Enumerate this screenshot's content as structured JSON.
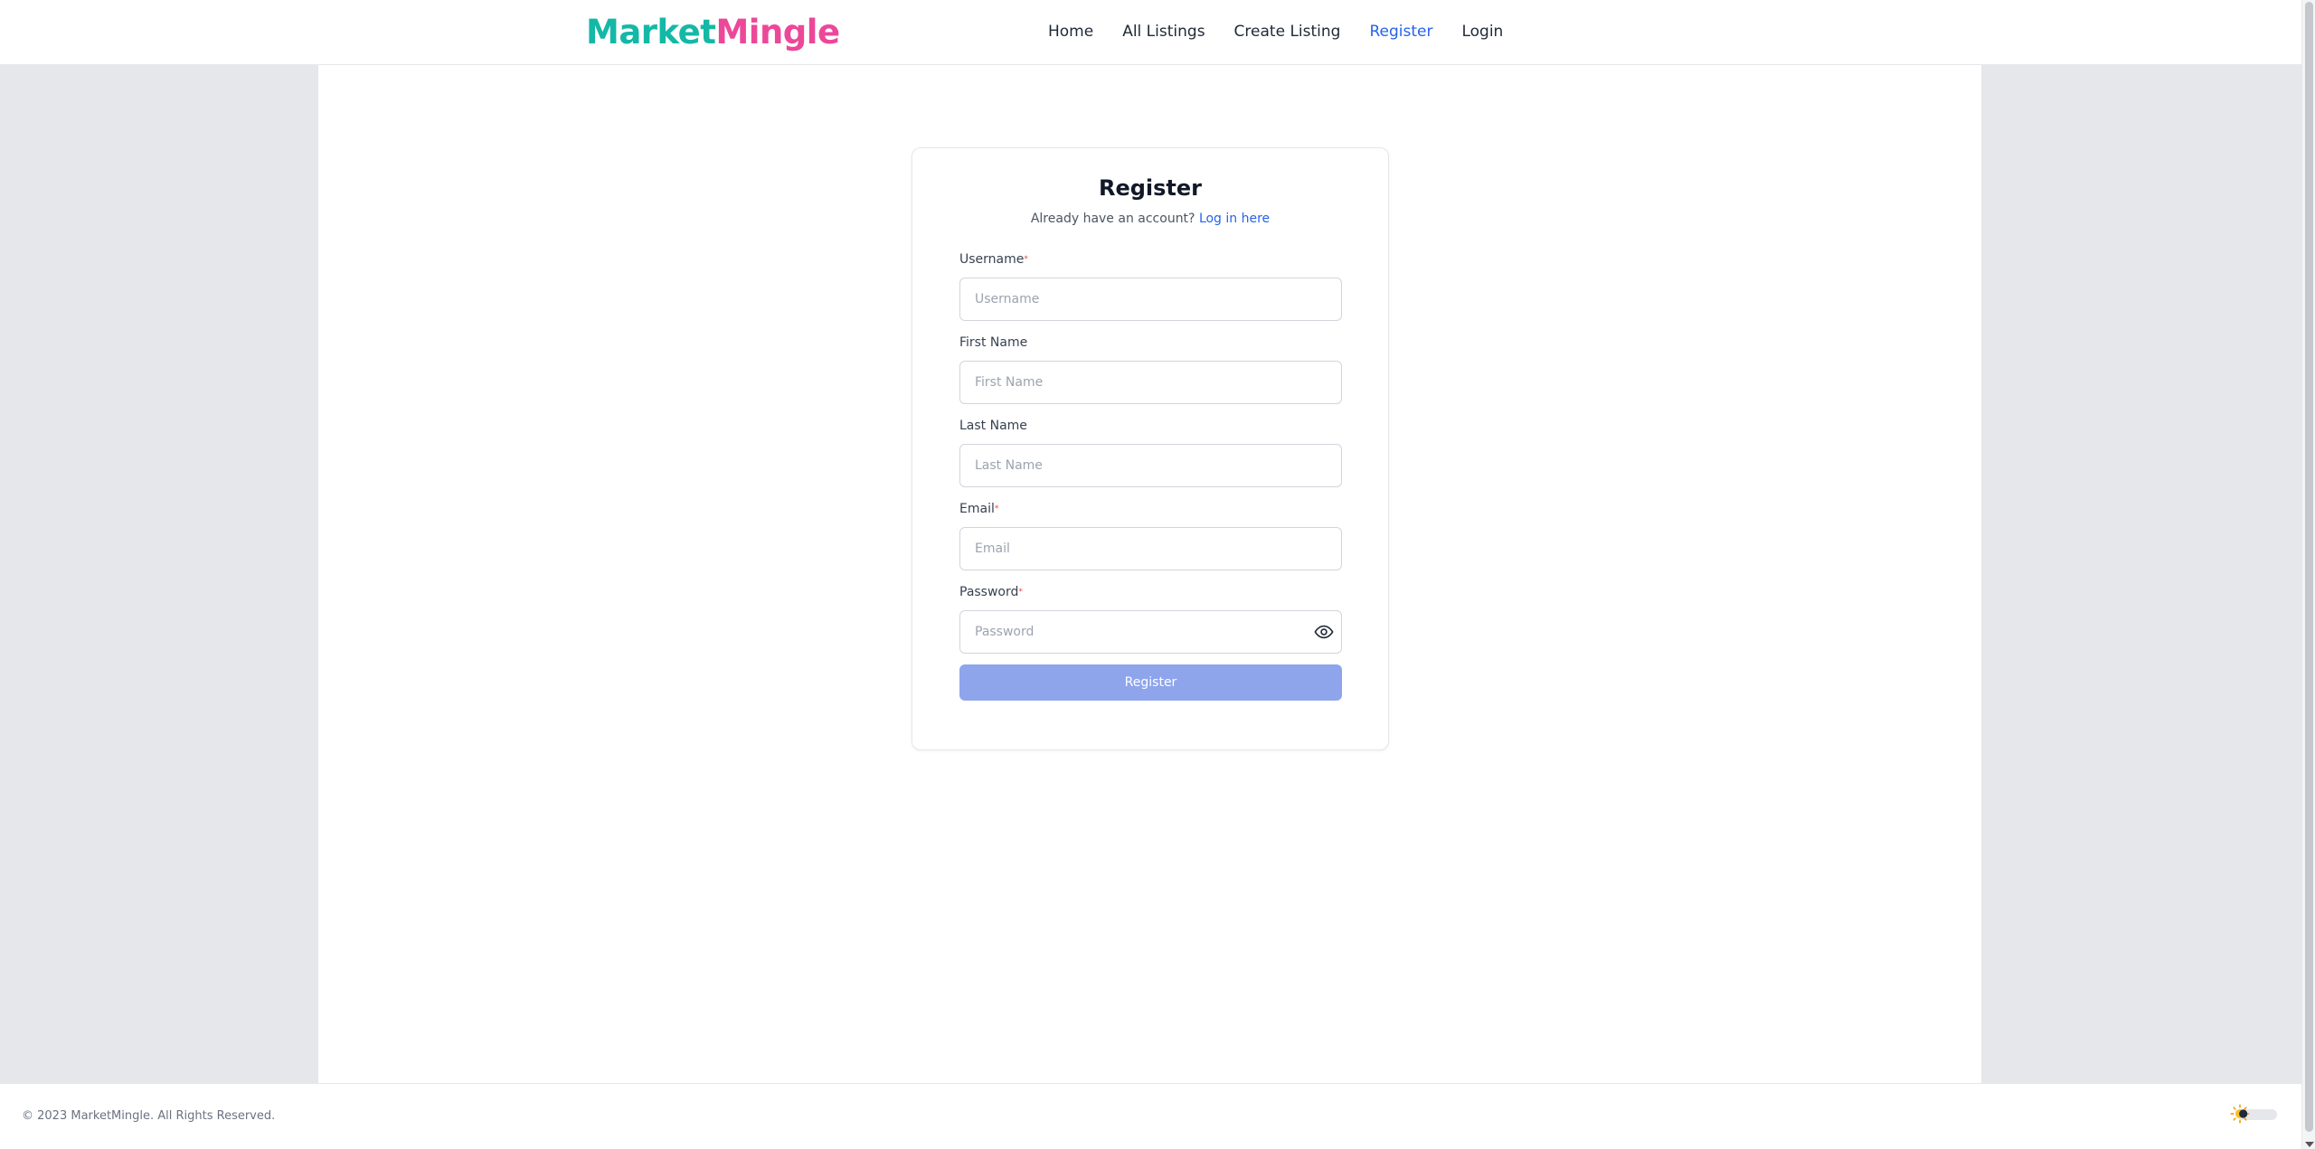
{
  "brand": {
    "part1": "Market",
    "part2": "Mingle",
    "color1": "#14b8a6",
    "color2": "#ec4899"
  },
  "nav": {
    "items": [
      {
        "label": "Home",
        "active": false
      },
      {
        "label": "All Listings",
        "active": false
      },
      {
        "label": "Create Listing",
        "active": false
      },
      {
        "label": "Register",
        "active": true
      },
      {
        "label": "Login",
        "active": false
      }
    ]
  },
  "form": {
    "title": "Register",
    "subtitle": "Already have an account?",
    "login_link": "Log in here",
    "fields": {
      "username": {
        "label": "Username",
        "required": "*",
        "placeholder": "Username",
        "value": ""
      },
      "first_name": {
        "label": "First Name",
        "placeholder": "First Name",
        "value": ""
      },
      "last_name": {
        "label": "Last Name",
        "placeholder": "Last Name",
        "value": ""
      },
      "email": {
        "label": "Email",
        "required": "*",
        "placeholder": "Email",
        "value": ""
      },
      "password": {
        "label": "Password",
        "required": "*",
        "placeholder": "Password",
        "value": ""
      }
    },
    "submit_label": "Register",
    "accent": "#2563eb",
    "submit_color": "#8ea5ec"
  },
  "footer": {
    "copyright": "© 2023 MarketMingle. All Rights Reserved.",
    "theme_toggle_icon": "sun-icon"
  }
}
